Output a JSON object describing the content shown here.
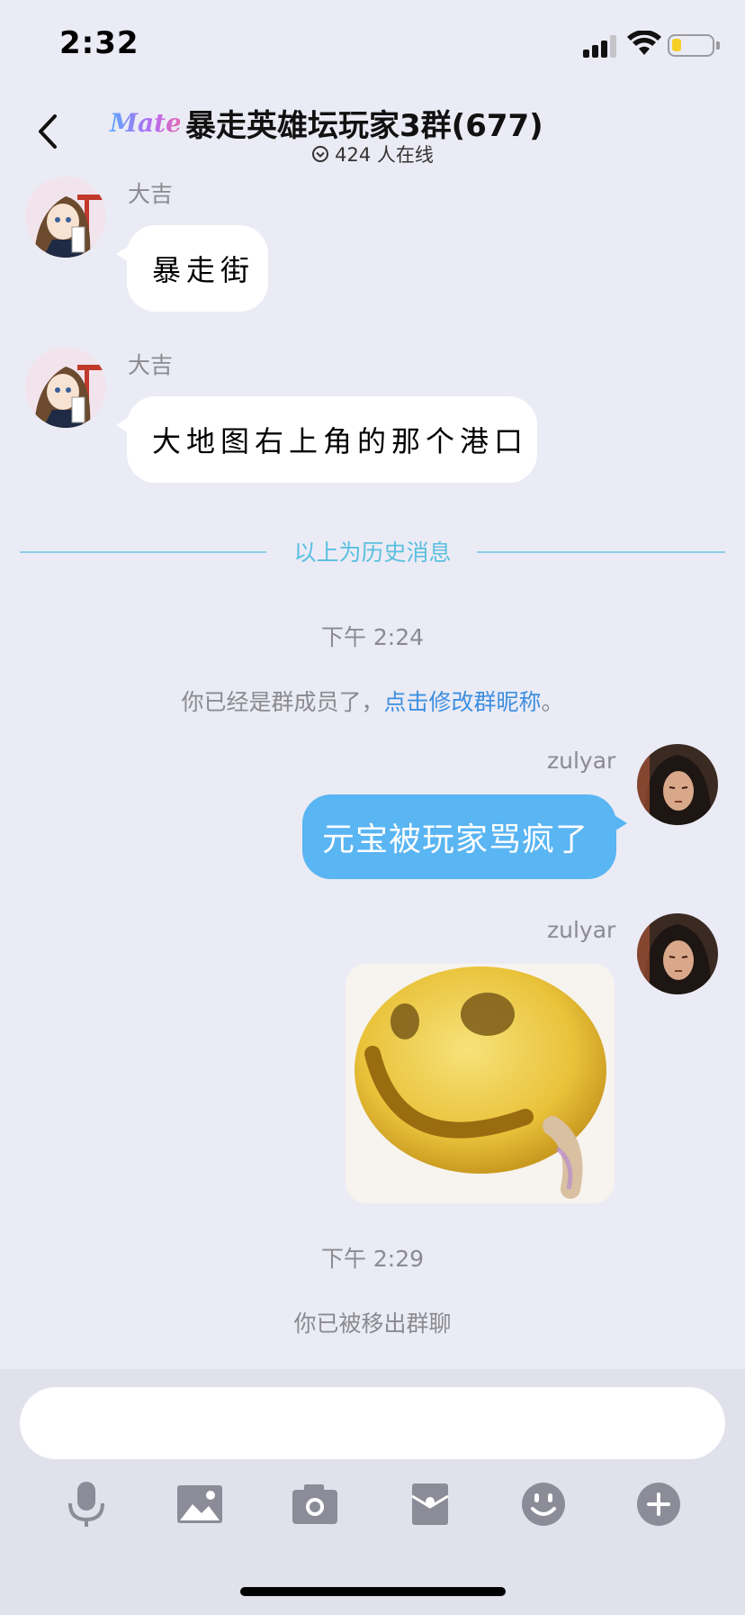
{
  "status_bar": {
    "time": "2:32"
  },
  "header": {
    "logo_text": "Matey",
    "title": "暴走英雄坛玩家3群(677)",
    "online_text": "424 人在线"
  },
  "messages": [
    {
      "sender": "大吉",
      "text": "暴走街"
    },
    {
      "sender": "大吉",
      "text": "大地图右上角的那个港口"
    }
  ],
  "history_divider": "以上为历史消息",
  "timestamp_1": "下午 2:24",
  "system_member": {
    "prefix": "你已经是群成员了，",
    "link": "点击修改群昵称",
    "suffix": "。"
  },
  "my_messages": [
    {
      "sender": "zulyar",
      "text": "元宝被玩家骂疯了"
    },
    {
      "sender": "zulyar",
      "sticker": "smiley-face-sticker"
    }
  ],
  "timestamp_2": "下午 2:29",
  "system_removed": "你已被移出群聊",
  "composer": {
    "placeholder": "",
    "tools": [
      "microphone-icon",
      "image-icon",
      "camera-icon",
      "gift-box-icon",
      "emoji-icon",
      "plus-icon"
    ]
  },
  "colors": {
    "background": "#ebebf5",
    "my_bubble": "#5ab5f3",
    "link": "#3d8fe0",
    "divider": "#5bbfe0",
    "battery_level": "#f6d028"
  }
}
